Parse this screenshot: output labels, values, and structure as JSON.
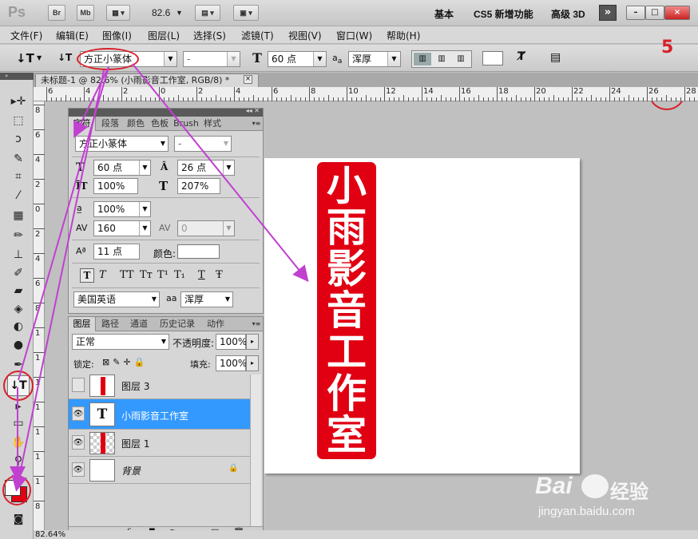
{
  "app": {
    "logo": "Ps"
  },
  "titlebar": {
    "buttons": [
      "Br",
      "Mb"
    ],
    "zoom": "82.6",
    "workspaces": [
      "基本",
      "CS5 新增功能",
      "高级 3D"
    ],
    "more": "»",
    "window_controls": [
      "–",
      "□",
      "×"
    ]
  },
  "menubar": {
    "items": [
      "文件(F)",
      "编辑(E)",
      "图像(I)",
      "图层(L)",
      "选择(S)",
      "滤镜(T)",
      "视图(V)",
      "窗口(W)",
      "帮助(H)"
    ]
  },
  "options": {
    "tool_icon": "↓T",
    "font_family": "方正小篆体",
    "font_style": "-",
    "font_size": "60 点",
    "aa_label": "a",
    "aa_value": "浑厚",
    "step_badge": "5"
  },
  "document": {
    "tab_title": "未标题-1 @ 82.6% (小雨影音工作室, RGB/8) *",
    "close": "×",
    "ruler_top": [
      "6",
      "4",
      "2",
      "0",
      "2",
      "4",
      "6",
      "8",
      "10",
      "12",
      "14",
      "16",
      "18",
      "20",
      "22",
      "24",
      "26",
      "28"
    ],
    "ruler_left": [
      "8",
      "6",
      "4",
      "2",
      "0",
      "2",
      "4",
      "6",
      "8",
      "1",
      "1",
      "1",
      "1",
      "1",
      "1",
      "1",
      "8"
    ],
    "seal_chars": [
      "小",
      "雨",
      "影",
      "音",
      "工",
      "作",
      "室"
    ]
  },
  "char_panel": {
    "tabs": [
      "字符",
      "段落",
      "颜色",
      "色板",
      "Brush",
      "样式"
    ],
    "font_family": "方正小篆体",
    "font_style": "-",
    "font_size": "60 点",
    "leading": "26 点",
    "vscale": "100%",
    "hscale": "207%",
    "tsume": "100%",
    "tracking": "160",
    "kerning": "0",
    "baseline": "11 点",
    "color_label": "颜色:",
    "style_buttons": [
      "T",
      "T",
      "TT",
      "Tт",
      "T¹",
      "T₁",
      "T",
      "Ŧ"
    ],
    "language": "美国英语",
    "aa_value": "浑厚"
  },
  "layers_panel": {
    "tabs": [
      "图层",
      "路径",
      "通道",
      "历史记录",
      "动作"
    ],
    "blend_mode": "正常",
    "opacity_label": "不透明度:",
    "opacity": "100%",
    "lock_label": "锁定:",
    "fill_label": "填充:",
    "fill": "100%",
    "layers": [
      {
        "name": "图层 3",
        "visible": false,
        "selected": false
      },
      {
        "name": "小雨影音工作室",
        "visible": true,
        "selected": true
      },
      {
        "name": "图层 1",
        "visible": true,
        "selected": false
      },
      {
        "name": "背景",
        "visible": true,
        "selected": false
      }
    ],
    "footer_icons": [
      "∞",
      "fx."
    ]
  },
  "status": {
    "zoom": "82.64%"
  },
  "watermark": {
    "brand": "Bai",
    "brand2": "经验",
    "url": "jingyan.baidu.com"
  },
  "colors": {
    "seal": "#e00012",
    "selection": "#3399ff",
    "annotation": "#d8202a",
    "arrow": "#c040d0"
  }
}
